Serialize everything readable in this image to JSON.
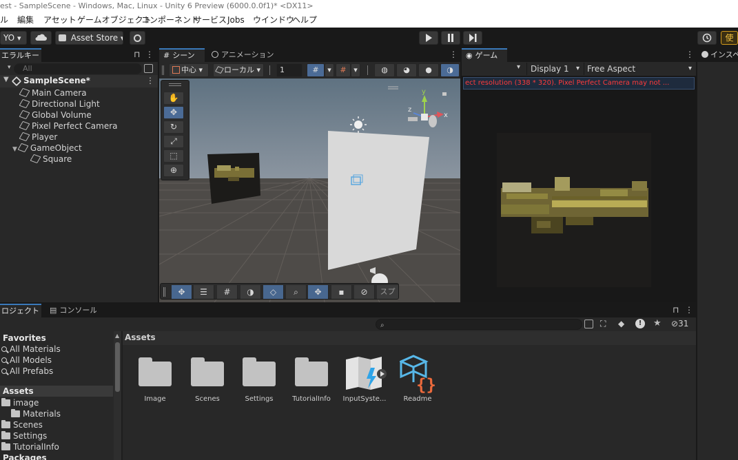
{
  "window_title": "est - SampleScene - Windows, Mac, Linux - Unity 6 Preview (6000.0.0f1)* <DX11>",
  "menu": [
    "ル",
    "編集",
    "アセット",
    "ゲームオブジェクト",
    "コンポーネント",
    "サービス",
    "Jobs",
    "ウインドウ",
    "ヘルプ"
  ],
  "toolbar": {
    "account": "YO",
    "asset_store": "Asset Store",
    "right_button": "使"
  },
  "hierarchy": {
    "tab": "エラルキー",
    "search_placeholder": "All",
    "scene": "SampleScene*",
    "items": [
      "Main Camera",
      "Directional Light",
      "Global Volume",
      "Pixel Perfect Camera",
      "Player",
      "GameObject",
      "Square"
    ]
  },
  "scene_view": {
    "tab": "シーン",
    "anim_tab": "アニメーション",
    "pivot": "中心",
    "space": "ローカル",
    "grid_value": "1",
    "sprite_button": "スプ"
  },
  "game_view": {
    "tab": "ゲーム",
    "display": "Display 1",
    "aspect": "Free Aspect",
    "warning": "ect resolution (338 * 320). Pixel Perfect Camera may not ..."
  },
  "inspector": {
    "tab": "インスペ"
  },
  "project": {
    "tab": "ロジェクト",
    "console_tab": "コンソール",
    "hidden_count": "31",
    "favorites_header": "Favorites",
    "favorites": [
      "All Materials",
      "All Models",
      "All Prefabs"
    ],
    "assets_header": "Assets",
    "tree": [
      "image",
      "Materials",
      "Scenes",
      "Settings",
      "TutorialInfo"
    ],
    "packages_header": "Packages",
    "breadcrumb": "Assets",
    "assets": [
      "Image",
      "Scenes",
      "Settings",
      "TutorialInfo",
      "InputSyste...",
      "Readme"
    ]
  },
  "colors": {
    "accent": "#3a79bb",
    "warning_text": "#ff3b3b",
    "selected": "#4b6b96"
  },
  "icons": [
    "unity-cube-icon",
    "folder-icon",
    "search-icon",
    "play-icon",
    "pause-icon",
    "step-icon",
    "lock-icon",
    "kebab-icon",
    "hand-tool-icon",
    "move-tool-icon",
    "rotate-tool-icon",
    "scale-tool-icon",
    "rect-tool-icon",
    "transform-tool-icon",
    "gizmo-axis-icon",
    "cloud-icon",
    "settings-icon",
    "history-icon"
  ]
}
